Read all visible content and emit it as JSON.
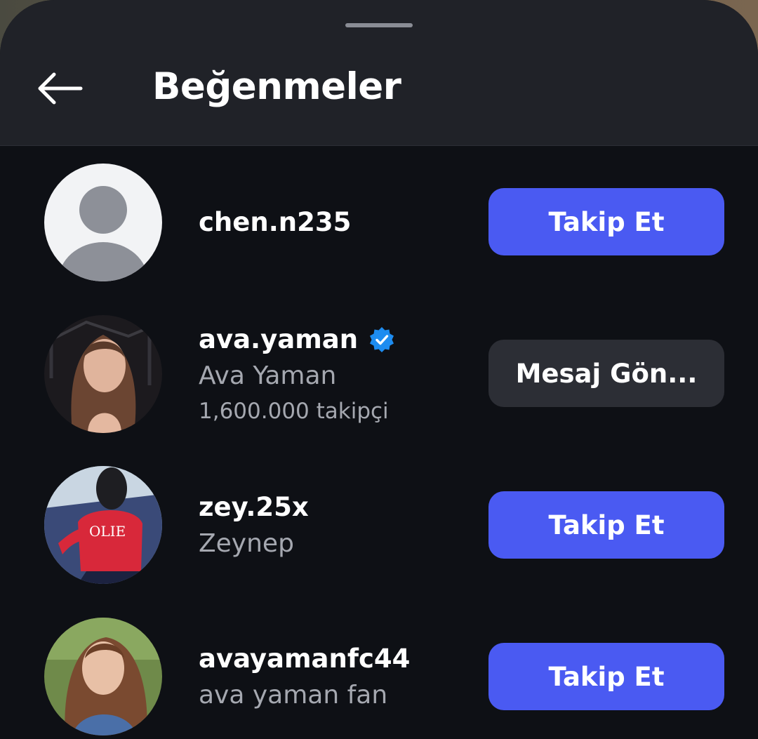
{
  "header": {
    "title": "Beğenmeler",
    "back_icon": "arrow-left-icon"
  },
  "colors": {
    "follow_button": "#4a5af2",
    "message_button": "#2c2e35",
    "verified_badge": "#1d8cf0",
    "background": "#0e1015",
    "header_background": "#202228"
  },
  "likers": [
    {
      "username": "chen.n235",
      "display_name": "",
      "followers": "",
      "verified": false,
      "avatar": "default-avatar-icon",
      "action_label": "Takip Et"
    },
    {
      "username": "ava.yaman",
      "display_name": "Ava Yaman",
      "followers": "1,600.000 takipçi",
      "verified": true,
      "avatar": "profile-photo",
      "action_label": "Mesaj Gön..."
    },
    {
      "username": "zey.25x",
      "display_name": "Zeynep",
      "followers": "",
      "verified": false,
      "avatar": "profile-photo",
      "action_label": "Takip Et"
    },
    {
      "username": "avayamanfc44",
      "display_name": "ava yaman fan",
      "followers": "",
      "verified": false,
      "avatar": "profile-photo",
      "action_label": "Takip Et"
    }
  ]
}
